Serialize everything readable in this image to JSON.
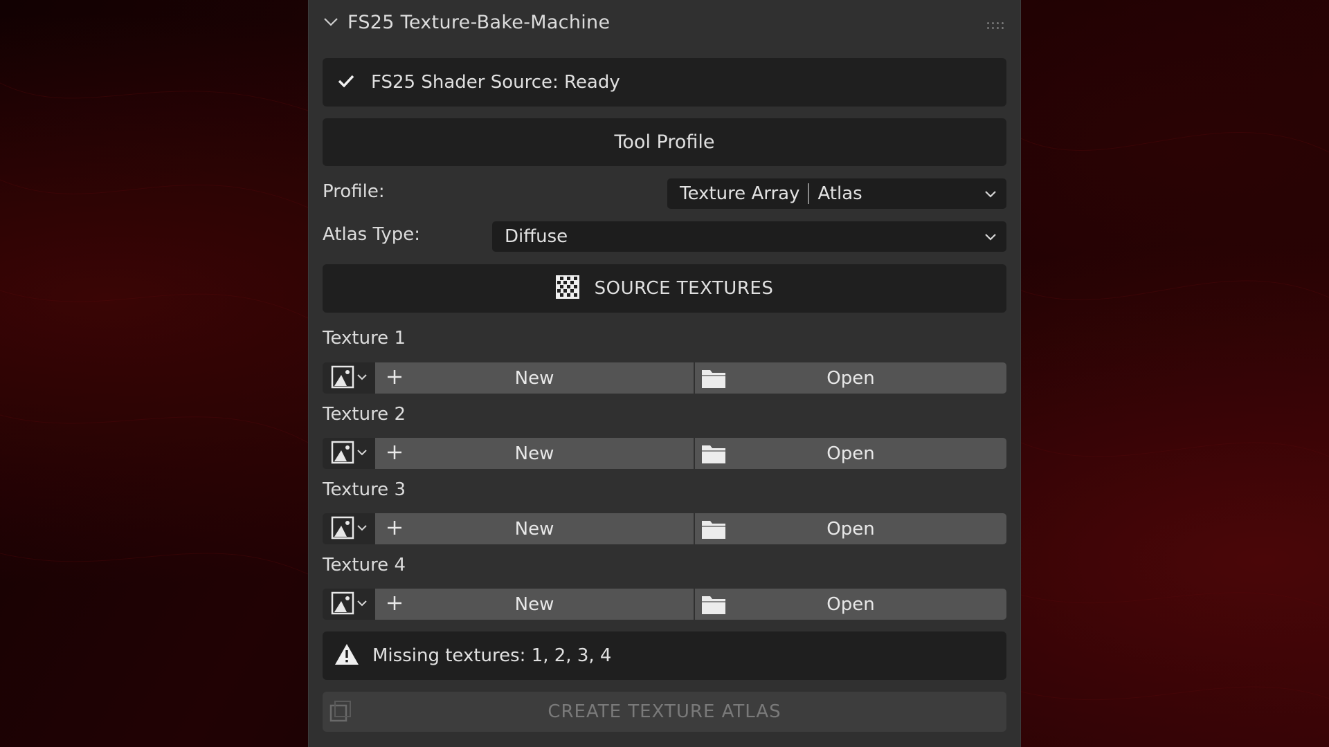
{
  "panel": {
    "title": "FS25 Texture-Bake-Machine",
    "status": "FS25 Shader Source: Ready",
    "tool_profile_label": "Tool Profile",
    "profile_label": "Profile:",
    "profile_value_a": "Texture Array",
    "profile_value_b": "Atlas",
    "atlas_type_label": "Atlas Type:",
    "atlas_type_value": "Diffuse",
    "source_textures_label": "SOURCE TEXTURES",
    "textures": [
      {
        "label": "Texture 1",
        "new_label": "New",
        "open_label": "Open"
      },
      {
        "label": "Texture 2",
        "new_label": "New",
        "open_label": "Open"
      },
      {
        "label": "Texture 3",
        "new_label": "New",
        "open_label": "Open"
      },
      {
        "label": "Texture 4",
        "new_label": "New",
        "open_label": "Open"
      }
    ],
    "warning": "Missing textures: 1, 2, 3, 4",
    "create_label": "CREATE TEXTURE ATLAS"
  },
  "icons": {
    "collapse": "chevron-down-icon",
    "status": "checkmark-icon",
    "source": "checker-icon",
    "image": "image-icon",
    "add": "plus-icon",
    "open": "folder-icon",
    "warning": "warning-icon",
    "create": "atlas-icon"
  },
  "colors": {
    "panel_bg": "#303030",
    "box_bg": "#1f1f1f",
    "button_bg": "#545454",
    "text": "#e0e0e0",
    "disabled_text": "#7a7a7a",
    "background_red": "#3a0505"
  }
}
